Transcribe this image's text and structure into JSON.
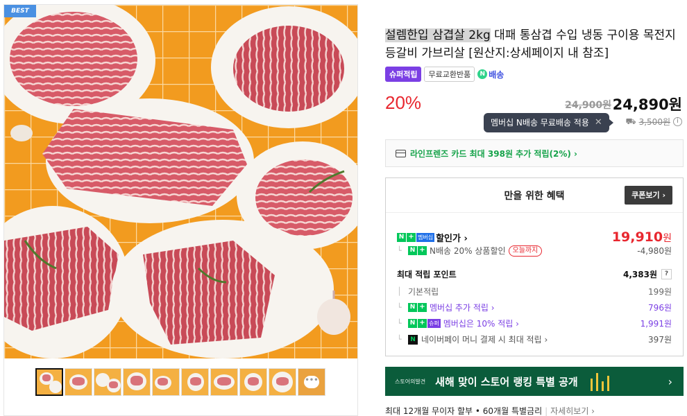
{
  "gallery": {
    "badge": "BEST",
    "thumbnail_count": 10,
    "more_icon": "ellipsis-icon"
  },
  "product": {
    "title_highlight": "설렘한입 삼겹살 2kg",
    "title_rest": " 대패 통삼겹 수입 냉동 구이용 목전지 등갈비 가브리살 [원산지:상세페이지 내 참조]",
    "badges": {
      "super": "슈퍼적립",
      "free_return": "무료교환반품",
      "n_delivery": "배송"
    },
    "discount_rate": "20%",
    "original_price": "24,900원",
    "sale_price": "24,890원"
  },
  "shipping": {
    "tooltip": "멤버십 N배송 무료배송 적용",
    "fee": "3,500원"
  },
  "card_promo": "라인프렌즈 카드 최대 398원 추가 적립(2%) ›",
  "benefits": {
    "title": "만을 위한 혜택",
    "coupon_button": "쿠폰보기 ›",
    "discount_label": "할인가 ›",
    "discount_price": "19,910",
    "won": "원",
    "n_delivery_discount_label": "N배송 20% 상품할인",
    "today_badge": "오늘까지",
    "n_delivery_discount_value": "-4,980원",
    "points_label": "최대 적립 포인트",
    "points_value": "4,383원",
    "help": "?",
    "base_label": "기본적립",
    "base_value": "199원",
    "membership_label": "멤버십 추가 적립 ›",
    "membership_value": "796원",
    "membership10_label": "멤버십은 10% 적립 ›",
    "membership10_value": "1,991원",
    "npay_label": "네이버페이 머니 결제 시 최대 적립 ›",
    "npay_value": "397원"
  },
  "banner": {
    "logo": "스토어의발견",
    "text": "새해 맞이 스토어 랭킹 특별 공개"
  },
  "installment": {
    "text": "최대 12개월 무이자 할부 • 60개월 특별금리",
    "more": "자세히보기 ›"
  },
  "colors": {
    "sale_red": "#e8272f",
    "naver_green": "#03c75a",
    "super_purple": "#7b3fe4",
    "banner_green": "#0b5c3b"
  }
}
